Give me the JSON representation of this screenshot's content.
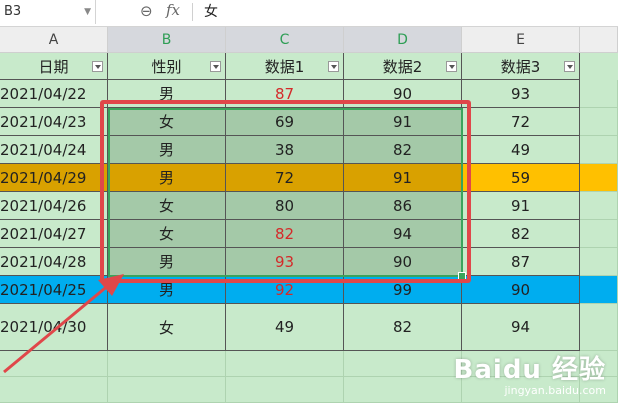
{
  "formula_bar": {
    "name_box": "B3",
    "fx_label": "fx",
    "value": "女"
  },
  "columns": [
    "A",
    "B",
    "C",
    "D",
    "E"
  ],
  "headers": [
    "日期",
    "性别",
    "数据1",
    "数据2",
    "数据3"
  ],
  "rows": [
    [
      "2021/04/22",
      "男",
      "87",
      "90",
      "93"
    ],
    [
      "2021/04/23",
      "女",
      "69",
      "91",
      "72"
    ],
    [
      "2021/04/24",
      "男",
      "38",
      "82",
      "49"
    ],
    [
      "2021/04/29",
      "男",
      "72",
      "91",
      "59"
    ],
    [
      "2021/04/26",
      "女",
      "80",
      "86",
      "91"
    ],
    [
      "2021/04/27",
      "女",
      "82",
      "94",
      "82"
    ],
    [
      "2021/04/28",
      "男",
      "93",
      "90",
      "87"
    ],
    [
      "2021/04/25",
      "男",
      "92",
      "99",
      "90"
    ],
    [
      "2021/04/30",
      "女",
      "49",
      "82",
      "94"
    ]
  ],
  "colors": {
    "highlight_orange": "#ffc000",
    "highlight_blue": "#00adef",
    "annotation_red": "#e0474a",
    "selection_green": "#3aa45c"
  },
  "watermark": {
    "title": "Baidu 经验",
    "url": "jingyan.baidu.com"
  }
}
